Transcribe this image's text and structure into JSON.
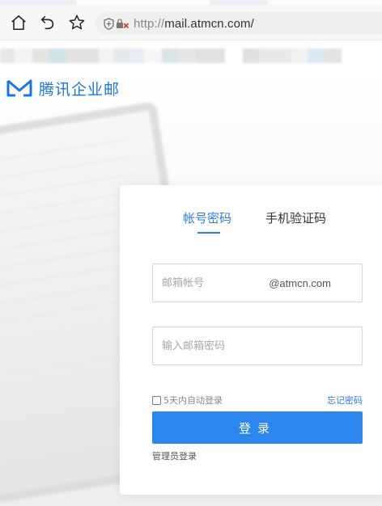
{
  "browser": {
    "url_scheme": "http://",
    "url_rest": "mail.atmcn.com/",
    "icons": [
      "home-icon",
      "back-icon",
      "star-icon",
      "shield-icon",
      "insecure-icon"
    ]
  },
  "logo": {
    "text": "腾讯企业邮",
    "color": "#1c76e0"
  },
  "login": {
    "tabs": [
      {
        "label": "帐号密码",
        "active": true
      },
      {
        "label": "手机验证码",
        "active": false
      }
    ],
    "account_placeholder": "邮箱帐号",
    "account_domain": "@atmcn.com",
    "password_placeholder": "输入邮箱密码",
    "remember_label": "5天内自动登录",
    "forgot_label": "忘记密码",
    "submit_label": "登录",
    "admin_label": "管理员登录",
    "accent_color": "#2c7be5",
    "button_color": "#2c86ee"
  }
}
